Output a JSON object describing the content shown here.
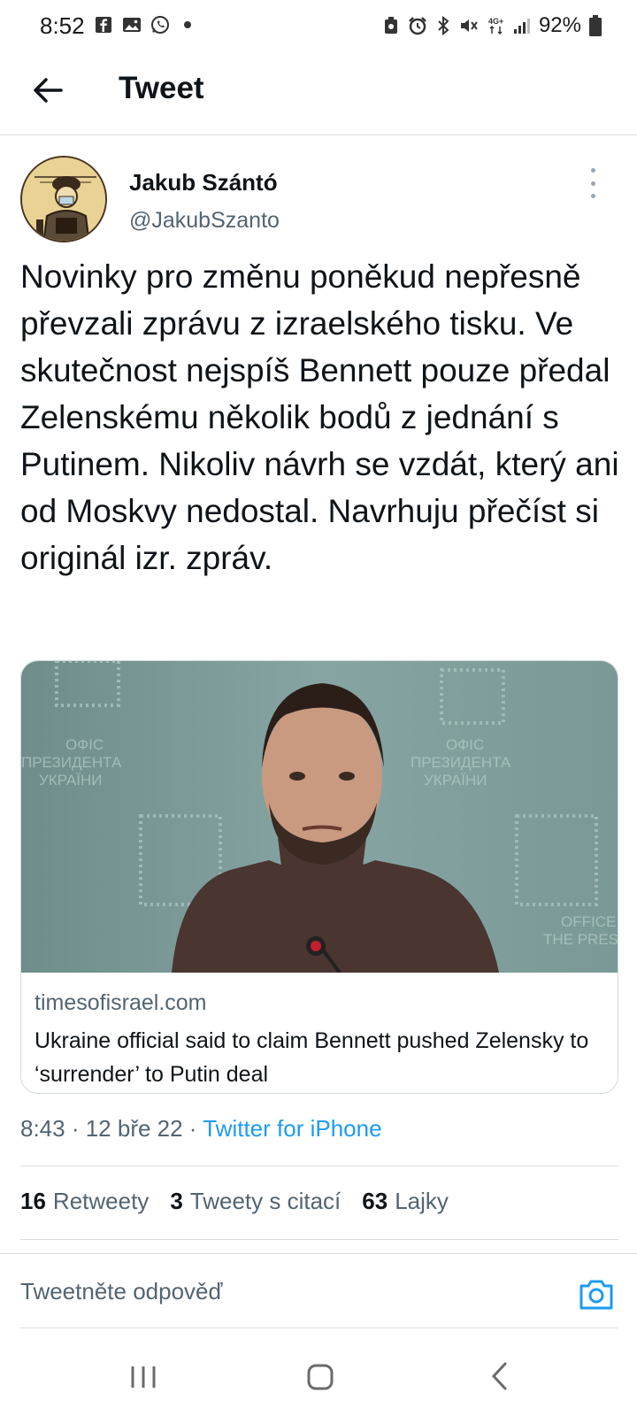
{
  "status_bar": {
    "time": "8:52",
    "left_icons": [
      "facebook-icon",
      "gallery-icon",
      "whatsapp-icon",
      "notification-dot"
    ],
    "right_icons": [
      "saver-icon",
      "alarm-icon",
      "bluetooth-icon",
      "mute-icon",
      "4g-icon",
      "signal-icon"
    ],
    "battery_text": "92%"
  },
  "header": {
    "title": "Tweet"
  },
  "tweet": {
    "author_name": "Jakub Szántó",
    "author_handle": "@JakubSzanto",
    "text": "Novinky pro změnu poněkud nepřesně převzali zprávu z izraelského tisku. Ve skutečnost nejspíš Bennett pouze předal Zelenskému několik bodů z jednání s Putinem. Nikoliv návrh se vzdát, který ani od Moskvy nedostal. Navrhuju přečíst si originál izr. zpráv.",
    "card": {
      "image_alt": "Volodymyr Zelensky at Office of the President podium",
      "domain": "timesofisrael.com",
      "title": "Ukraine official said to claim Bennett pushed Zelensky to ‘surrender’ to Putin deal"
    },
    "meta": {
      "time_date": "8:43 · 12 bře 22 · ",
      "source": "Twitter for iPhone"
    },
    "stats": {
      "retweets_count": "16",
      "retweets_label": "Retweety",
      "quotes_count": "3",
      "quotes_label": "Tweety s citací",
      "likes_count": "63",
      "likes_label": "Lajky"
    }
  },
  "reply": {
    "placeholder": "Tweetněte odpověď"
  },
  "colors": {
    "accent": "#1d9bf0",
    "secondary_text": "#536471",
    "divider": "#d9dde1"
  }
}
